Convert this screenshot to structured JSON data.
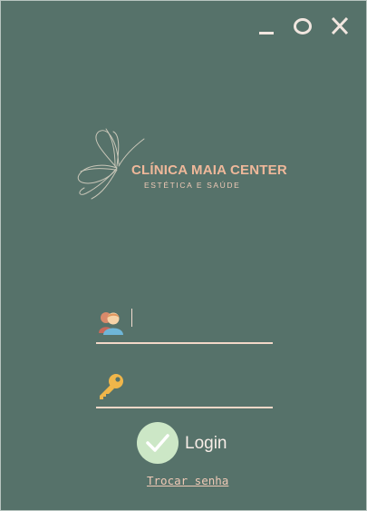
{
  "window": {
    "minimize_icon": "minimize-icon",
    "maximize_label": "O",
    "close_label": "X"
  },
  "branding": {
    "name": "CLÍNICA MAIA CENTER",
    "tagline": "ESTÉTICA E SAÚDE",
    "logo_icon": "butterfly-icon"
  },
  "form": {
    "username_icon": "users-icon",
    "username_value": "",
    "password_icon": "key-icon",
    "password_value": "",
    "login_label": "Login",
    "login_icon": "check-icon",
    "change_password_label": "Trocar senha"
  },
  "colors": {
    "background": "#56726a",
    "accent": "#efb89a",
    "check_circle": "#cce7c6"
  }
}
